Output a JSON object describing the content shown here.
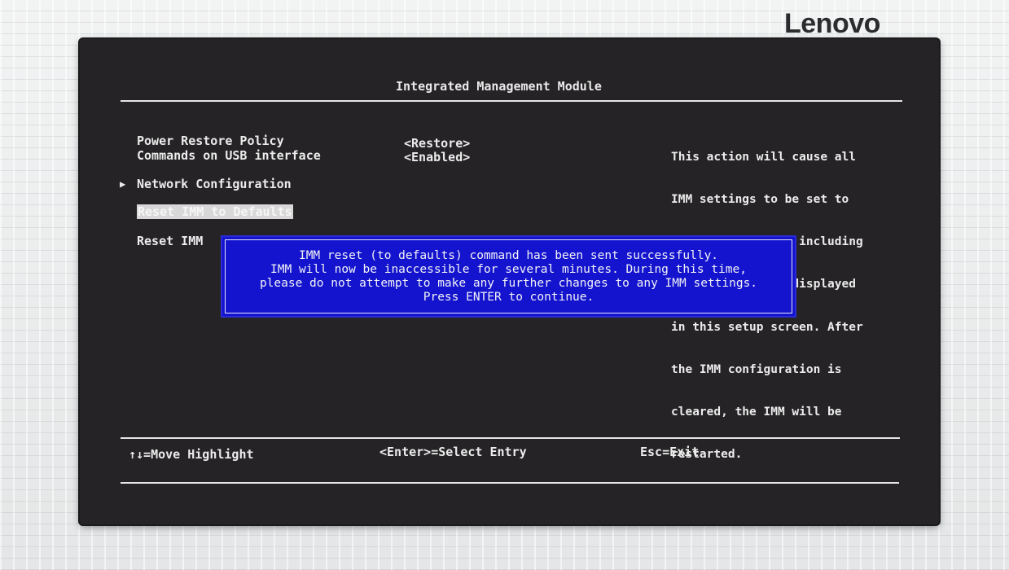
{
  "brand": {
    "logo_text": "Lenovo"
  },
  "window": {
    "title": "Integrated Management Module"
  },
  "menu": {
    "items": [
      {
        "label": "Power Restore Policy",
        "value": "<Restore>"
      },
      {
        "label": "Commands on USB interface",
        "value": "<Enabled>"
      },
      {
        "label": "Network Configuration",
        "submenu_arrow": "▶"
      },
      {
        "label": "Reset IMM to Defaults",
        "highlighted": true
      },
      {
        "label": "Reset IMM"
      }
    ]
  },
  "help_panel": {
    "lines": [
      "This action will cause all",
      "IMM settings to be set to",
      "factory defaults, including",
      "the IMM settings displayed",
      "in this setup screen. After",
      "the IMM configuration is",
      "cleared, the IMM will be",
      "restarted."
    ]
  },
  "dialog": {
    "lines": [
      "IMM reset (to defaults) command has been sent successfully.",
      "IMM will now be inaccessible for several minutes. During this time,",
      "please do not attempt to make any further changes to any IMM settings.",
      "Press ENTER to continue."
    ],
    "background_color": "#1414cf"
  },
  "footer": {
    "move_hint": "↑↓=Move Highlight",
    "select_hint": "<Enter>=Select Entry",
    "exit_hint": "Esc=Exit"
  },
  "colors": {
    "screen_background": "#252325",
    "text": "#ececec",
    "dialog_blue": "#1414cf"
  }
}
